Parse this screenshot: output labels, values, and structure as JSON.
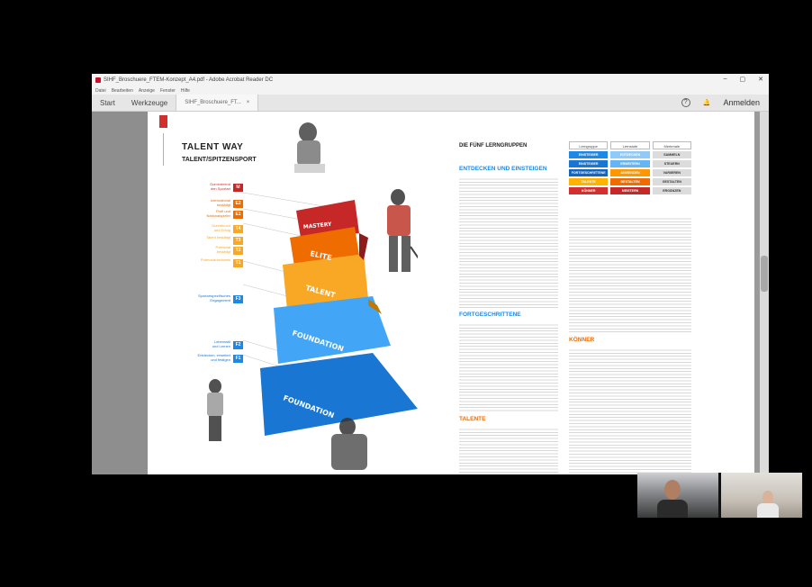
{
  "window": {
    "title": "SIHF_Broschuere_FTEM-Konzept_A4.pdf - Adobe Acrobat Reader DC",
    "controls": [
      "–",
      "▢",
      "✕"
    ],
    "menu": [
      "Datei",
      "Bearbeiten",
      "Anzeige",
      "Fenster",
      "Hilfe"
    ]
  },
  "tabs": {
    "start": "Start",
    "tools": "Werkzeuge",
    "doc": "SIHF_Broschuere_FT...",
    "doc_close": "×",
    "help": "?",
    "notifications": "🔔",
    "signin": "Anmelden"
  },
  "page": {
    "title": "TALENT WAY",
    "subtitle": "TALENT/SPITZENSPORT",
    "steps": [
      {
        "badge": "M",
        "label": "Dominierend\nden Sportart",
        "color": "#c62828",
        "cls": "r"
      },
      {
        "badge": "E2",
        "label": "International\nbestätigt",
        "color": "#ef6c00",
        "cls": "o"
      },
      {
        "badge": "E1",
        "label": "Profi und\nNationalspieler",
        "color": "#ef6c00",
        "cls": "o"
      },
      {
        "badge": "T4",
        "label": "Durchbruch\nund Erfolg",
        "color": "#f9a825",
        "cls": "y"
      },
      {
        "badge": "T3",
        "label": "Talent bestätigt",
        "color": "#f9a825",
        "cls": "y"
      },
      {
        "badge": "T2",
        "label": "Potenzial\nbestätigt",
        "color": "#f9a825",
        "cls": "y"
      },
      {
        "badge": "T1",
        "label": "Potenzialnachweis",
        "color": "#f9a825",
        "cls": "y"
      },
      {
        "badge": "F3",
        "label": "Sportartspezifisches\nEngagement",
        "color": "#1e88e5",
        "cls": "b"
      },
      {
        "badge": "F2",
        "label": "Lebensstil\nund Lernen",
        "color": "#1e88e5",
        "cls": "b"
      },
      {
        "badge": "F1",
        "label": "Entdecken, erweitert\nund festigen",
        "color": "#1e88e5",
        "cls": "b"
      }
    ],
    "levels": [
      "MASTERY",
      "ELITE",
      "TALENT",
      "FOUNDATION",
      "FOUNDATION"
    ],
    "col1": {
      "heading": "DIE FÜNF LERNGRUPPEN",
      "sub1": "ENTDECKEN UND EINSTEIGEN",
      "sub2": "FORTGESCHRITTENE",
      "sub3": "TALENTE"
    },
    "col2": {
      "sub1": "KÖNNER"
    },
    "table": {
      "headers": [
        "Lerngruppe",
        "Lernstufe",
        "Merkmale"
      ],
      "rows": [
        [
          "EINSTEIGER",
          "ENTDECKEN",
          "SAMMELN"
        ],
        [
          "EINSTEIGER",
          "ERWEITERN",
          "STEUERN"
        ],
        [
          "FORTGESCHRITTENE",
          "ANWENDEN",
          "VARIIEREN"
        ],
        [
          "TALENTE",
          "GESTALTEN",
          "GESTALTEN"
        ],
        [
          "KÖNNER",
          "MEISTERN",
          "ERGÄNZEN"
        ]
      ]
    }
  }
}
